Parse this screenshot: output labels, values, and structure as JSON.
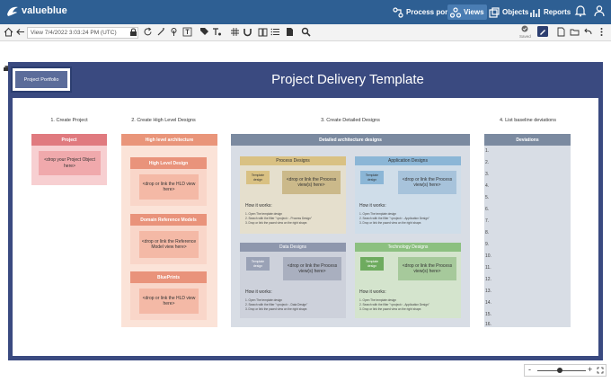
{
  "app": {
    "brand": "valueblue"
  },
  "nav": {
    "process_portal": "Process portal",
    "views": "Views",
    "objects": "Objects",
    "reports": "Reports"
  },
  "toolbar": {
    "view_field": "View 7/4/2022 3:03:24 PM (UTC)",
    "saved": "Saved"
  },
  "canvas": {
    "title": "Project Delivery Template",
    "portfolio": "Project Portfolio",
    "sections": {
      "create_project": "1. Create Project",
      "create_hld": "2. Create High Level Designs",
      "create_detailed": "3. Create Detailed Designs",
      "baseline": "4. List baseline deviations"
    },
    "project": {
      "header": "Project",
      "drop": "<drop your Project Object here>"
    },
    "hla": {
      "header": "High level architecture",
      "hld": {
        "header": "High Level Design",
        "drop": "<drop or link the HLD view here>"
      },
      "domain": {
        "header": "Domain Reference Models",
        "drop": "<drop or link the Reference Model view here>"
      },
      "blueprints": {
        "header": "BluePrints",
        "drop": "<drop or link the HLD view here>"
      }
    },
    "detailed": {
      "header": "Detailed architecture designs",
      "how_it_works": "How it works:",
      "process": {
        "header": "Process Designs",
        "template": "Template design",
        "drop": "<drop or link the Process view(s) here>",
        "steps": [
          "1. Open The template design",
          "2. Search with the filter \"<project> - Process Design\"",
          "3. Drop or link the paced view on the right shape."
        ]
      },
      "application": {
        "header": "Application Designs",
        "template": "Template design",
        "drop": "<drop or link the Process view(s) here>",
        "steps": [
          "1. Open The template design",
          "2. Search with the filter \"<project> - Application Design\"",
          "3. Drop or link the paced view on the right shape."
        ]
      },
      "data": {
        "header": "Data Designs",
        "template": "Template design",
        "drop": "<drop or link the Process view(s) here>",
        "steps": [
          "1. Open The template design",
          "2. Search with the filter \"<project> - Data Design\"",
          "3. Drop or link the paced view on the right shape."
        ]
      },
      "technology": {
        "header": "Technology Designs",
        "template": "Template design",
        "drop": "<drop or link the Process view(s) here>",
        "steps": [
          "1. Open The template design",
          "2. Search with the filter \"<project> - Application Design\"",
          "3. Drop or link the paced view on the right shape."
        ]
      }
    },
    "deviations": {
      "header": "Deviations",
      "items": [
        "1.",
        "2.",
        "3.",
        "4.",
        "5.",
        "6.",
        "7.",
        "8.",
        "9.",
        "10.",
        "11.",
        "12.",
        "13.",
        "14.",
        "15.",
        "16."
      ]
    }
  },
  "zoom": {
    "minus": "-",
    "plus": "+"
  },
  "colors": {
    "topbar": "#2e5f93",
    "frame": "#3a4a80",
    "project": "#e07a7f",
    "hla": "#e9957a",
    "detailed": "#7b8aa0",
    "process": "#d9c183",
    "application": "#8bb6d6",
    "data": "#8e97ad",
    "technology": "#8cc080",
    "deviations": "#7b8aa0"
  }
}
